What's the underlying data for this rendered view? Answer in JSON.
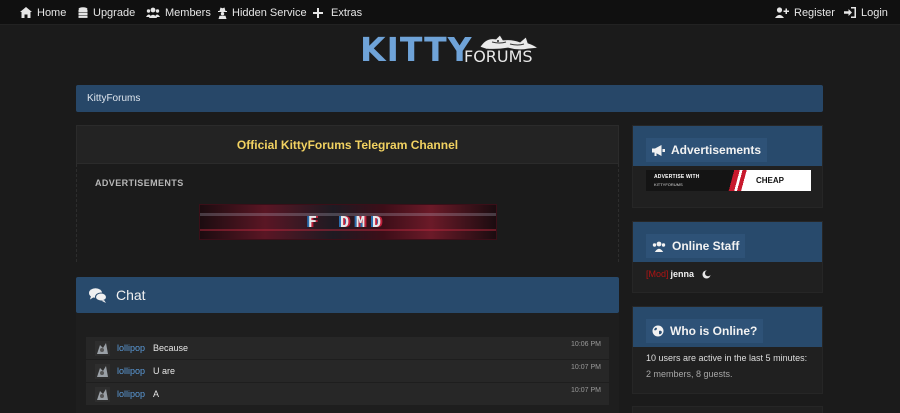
{
  "nav": {
    "left": [
      {
        "label": "Home",
        "icon": "home-icon"
      },
      {
        "label": "Upgrade",
        "icon": "coins-icon"
      },
      {
        "label": "Members",
        "icon": "users-icon"
      },
      {
        "label": "Hidden Service",
        "icon": "user-secret-icon"
      },
      {
        "label": "Extras",
        "icon": "plus-icon"
      }
    ],
    "right": [
      {
        "label": "Register",
        "icon": "user-plus-icon"
      },
      {
        "label": "Login",
        "icon": "sign-in-icon"
      }
    ]
  },
  "logo": {
    "primary": "KITTY",
    "secondary": "FORUMS"
  },
  "breadcrumb": "KittyForums",
  "telegram_link": "Official KittyForums Telegram Channel",
  "ads": {
    "heading": "ADVERTISEMENTS",
    "banner_text": "F  DMD"
  },
  "chat": {
    "title": "Chat",
    "messages": [
      {
        "user": "lollipop",
        "text": "Because",
        "time": "10:06 PM"
      },
      {
        "user": "lollipop",
        "text": "U are",
        "time": "10:07 PM"
      },
      {
        "user": "lollipop",
        "text": "A",
        "time": "10:07 PM"
      }
    ]
  },
  "sidebar": {
    "advertisements": {
      "title": "Advertisements",
      "banner_line1": "ADVERTISE WITH",
      "banner_line2": "KITTYFORUMS",
      "banner_cta": "CHEAP"
    },
    "online_staff": {
      "title": "Online Staff",
      "staff": [
        {
          "tag": "[Mod]",
          "name": "jenna"
        }
      ]
    },
    "who_online": {
      "title": "Who is Online?",
      "summary": "10 users are active in the last 5 minutes:",
      "detail": "2 members, 8 guests."
    }
  },
  "colors": {
    "accent_blue": "#284a6c",
    "link_blue": "#5a9ad8",
    "telegram_yellow": "#f2d261",
    "mod_red": "#b01414",
    "background": "#1b1b1b"
  }
}
